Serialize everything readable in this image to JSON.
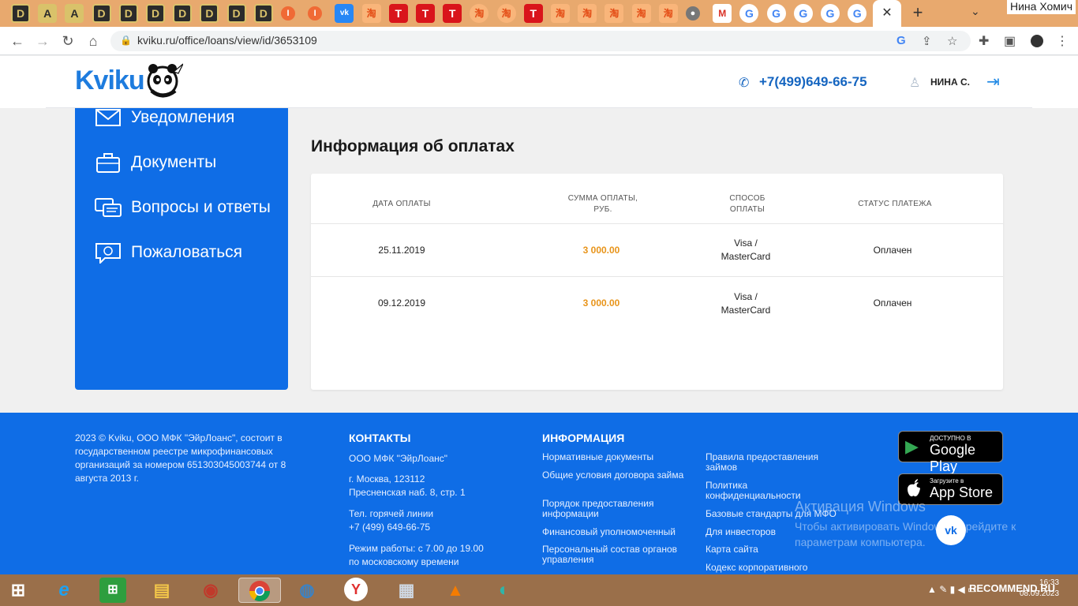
{
  "browser": {
    "tabs": [
      {
        "glyph": "D",
        "kind": "d"
      },
      {
        "glyph": "A",
        "kind": "a"
      },
      {
        "glyph": "A",
        "kind": "a"
      },
      {
        "glyph": "D",
        "kind": "d"
      },
      {
        "glyph": "D",
        "kind": "d"
      },
      {
        "glyph": "D",
        "kind": "d"
      },
      {
        "glyph": "D",
        "kind": "d"
      },
      {
        "glyph": "D",
        "kind": "d"
      },
      {
        "glyph": "D",
        "kind": "d"
      },
      {
        "glyph": "D",
        "kind": "d"
      },
      {
        "glyph": "I",
        "kind": "orange"
      },
      {
        "glyph": "I",
        "kind": "orange"
      },
      {
        "glyph": "vk",
        "kind": "vk"
      },
      {
        "glyph": "淘",
        "kind": "cn"
      },
      {
        "glyph": "T",
        "kind": "t"
      },
      {
        "glyph": "T",
        "kind": "t"
      },
      {
        "glyph": "T",
        "kind": "t"
      },
      {
        "glyph": "淘",
        "kind": "cn2"
      },
      {
        "glyph": "淘",
        "kind": "cn2"
      },
      {
        "glyph": "T",
        "kind": "t"
      },
      {
        "glyph": "淘",
        "kind": "cn"
      },
      {
        "glyph": "淘",
        "kind": "cn"
      },
      {
        "glyph": "淘",
        "kind": "cn"
      },
      {
        "glyph": "淘",
        "kind": "cn"
      },
      {
        "glyph": "淘",
        "kind": "cn"
      },
      {
        "glyph": "●",
        "kind": "globe"
      },
      {
        "glyph": "M",
        "kind": "gmail"
      },
      {
        "glyph": "G",
        "kind": "g"
      },
      {
        "glyph": "G",
        "kind": "g"
      },
      {
        "glyph": "G",
        "kind": "g"
      },
      {
        "glyph": "G",
        "kind": "g"
      },
      {
        "glyph": "G",
        "kind": "g"
      }
    ],
    "active_tab_close": "✕",
    "new_tab": "+",
    "tab_menu": "⌄",
    "window_user": "Нина Хомич",
    "url": "kviku.ru/office/loans/view/id/3653109"
  },
  "header": {
    "logo": "Kviku",
    "phone": "+7(499)649-66-75",
    "user": "НИНА С."
  },
  "sidebar": {
    "items": [
      {
        "label": "Уведомления",
        "icon": "envelope-icon"
      },
      {
        "label": "Документы",
        "icon": "briefcase-icon"
      },
      {
        "label": "Вопросы и ответы",
        "icon": "chat-icon"
      },
      {
        "label": "Пожаловаться",
        "icon": "complaint-icon"
      }
    ]
  },
  "main": {
    "title": "Информация об оплатах",
    "table": {
      "headers": [
        "ДАТА ОПЛАТЫ",
        "СУММА ОПЛАТЫ,\nРУБ.",
        "СПОСОБ\nОПЛАТЫ",
        "СТАТУС ПЛАТЕЖА"
      ],
      "rows": [
        {
          "date": "25.11.2019",
          "sum": "3 000.00",
          "method": "Visa /\nMasterCard",
          "status": "Оплачен"
        },
        {
          "date": "09.12.2019",
          "sum": "3 000.00",
          "method": "Visa /\nMasterCard",
          "status": "Оплачен"
        }
      ]
    }
  },
  "footer": {
    "copyright": "2023 © Kviku, ООО МФК \"ЭйрЛоанс\", состоит в государственном реестре микрофинансовых организаций за номером 651303045003744 от 8 августа 2013 г.",
    "contacts": {
      "title": "КОНТАКТЫ",
      "company": "ООО МФК \"ЭйрЛоанс\"",
      "address": "г. Москва, 123112\nПресненская наб. 8, стр. 1",
      "hotline": "Тел. горячей линии\n+7 (499) 649-66-75",
      "hours": "Режим работы: с 7.00 до 19.00\nпо московскому времени"
    },
    "info": {
      "title": "ИНФОРМАЦИЯ",
      "col1": [
        "Нормативные документы",
        "Общие условия договора займа",
        "Порядок предоставления информации",
        "Финансовый уполномоченный",
        "Персональный состав органов управления"
      ],
      "col2": [
        "Правила предоставления займов",
        "Политика конфиденциальности",
        "Базовые стандарты для МФО",
        "Для инвесторов",
        "Карта сайта",
        "Кодекс корпоративного"
      ]
    },
    "stores": [
      {
        "small": "ДОСТУПНО В",
        "big": "Google Play",
        "icon": "▶"
      },
      {
        "small": "Загрузите в",
        "big": "App Store",
        "icon": ""
      }
    ],
    "activation_title": "Активация Windows",
    "activation_text": "Чтобы активировать Windows, перейдите к параметрам компьютера.",
    "vk_badge": "vk"
  },
  "taskbar": {
    "clock_time": "16:33",
    "clock_date": "08.09.2023",
    "recommend": "RECOMMEND.RU",
    "tray": "▲ ✎ ▮ ◀ ▭"
  }
}
